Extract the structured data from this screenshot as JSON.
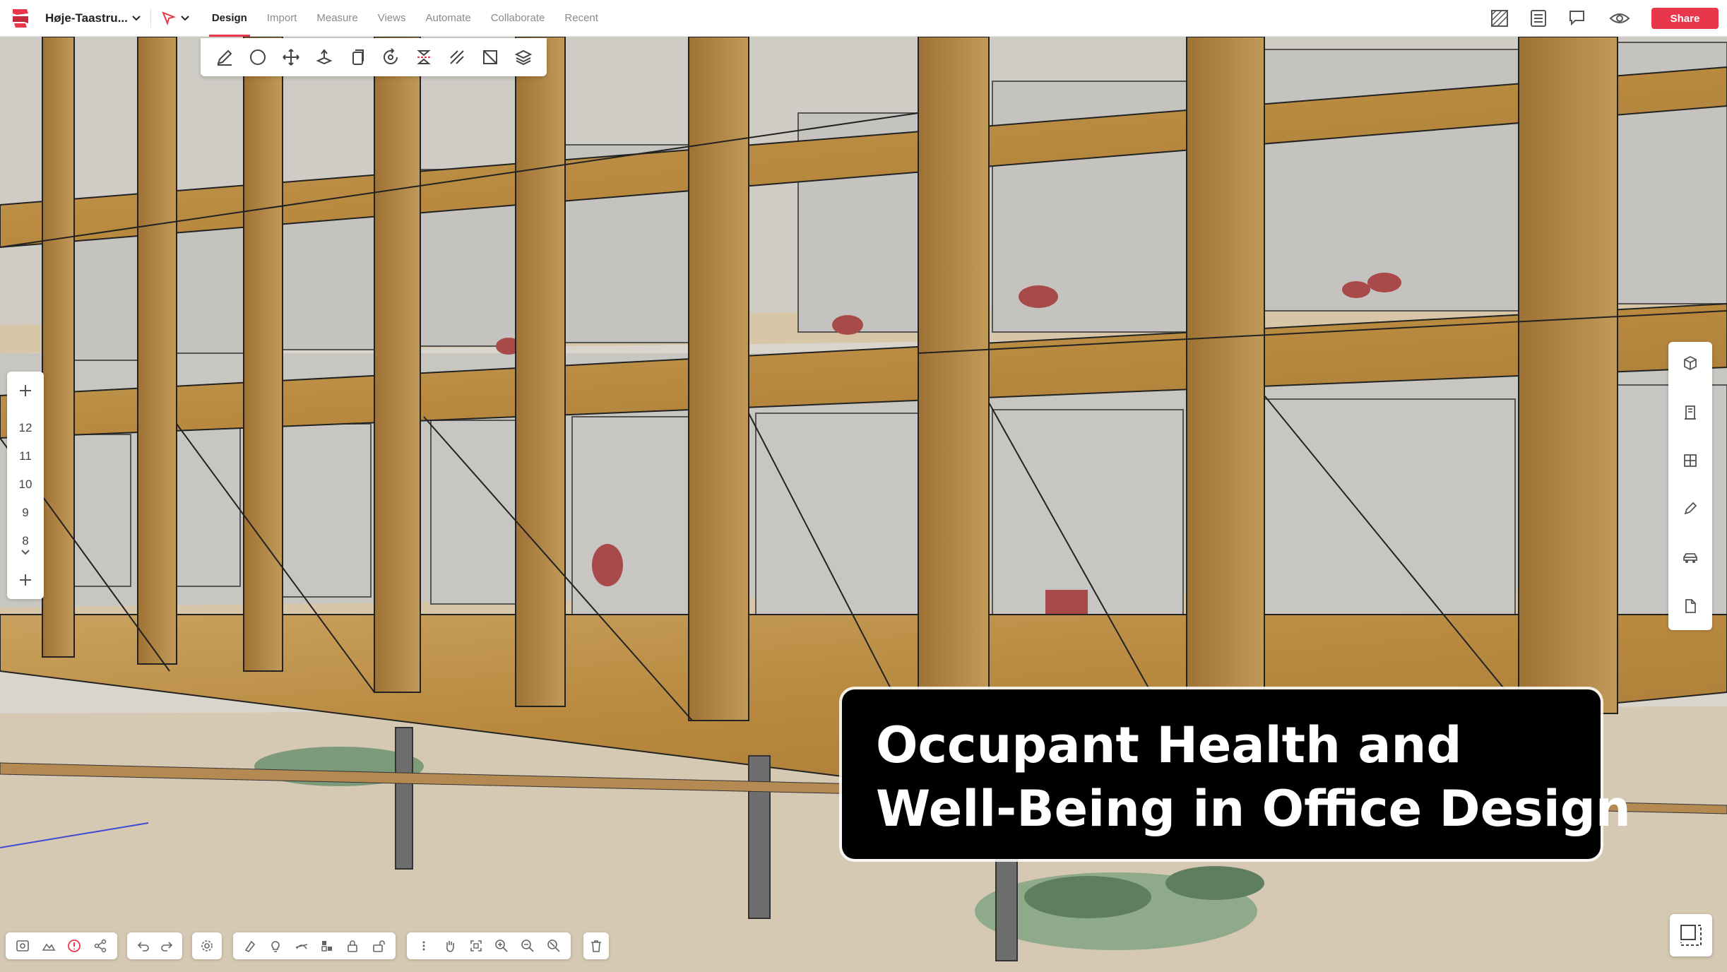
{
  "app": {
    "brand_color": "#e8374b"
  },
  "project": {
    "name": "Høje-Taastru..."
  },
  "menu": {
    "items": [
      "Design",
      "Import",
      "Measure",
      "Views",
      "Automate",
      "Collaborate",
      "Recent"
    ],
    "active": "Design"
  },
  "toolbar": {
    "share_label": "Share"
  },
  "design_tools": [
    "pencil-icon",
    "circle-icon",
    "move-icon",
    "extrude-icon",
    "copy-icon",
    "rotate-icon",
    "mirror-icon",
    "offset-icon",
    "section-icon",
    "layers-icon"
  ],
  "floors": {
    "levels": [
      "12",
      "11",
      "10",
      "9",
      "8"
    ]
  },
  "right_tools": [
    "cube-icon",
    "column-icon",
    "grid-icon",
    "pen-icon",
    "car-icon",
    "document-icon"
  ],
  "caption": {
    "line1": "Occupant Health and",
    "line2": "Well-Being in Office Design"
  },
  "bottom_tools": {
    "group1": [
      "visibility-icon",
      "terrain-icon",
      "warning-icon",
      "share-icon"
    ],
    "group2": [
      "undo-icon",
      "redo-icon"
    ],
    "group3": [
      "settings-icon"
    ],
    "group4": [
      "paint-icon",
      "light-icon",
      "sun-icon",
      "material-icon",
      "lock-icon",
      "unlock-icon"
    ],
    "group5": [
      "more-icon",
      "pan-icon",
      "fit-icon",
      "zoom-in-icon",
      "zoom-out-icon",
      "zoom-extents-icon"
    ],
    "group6": [
      "delete-icon"
    ]
  }
}
